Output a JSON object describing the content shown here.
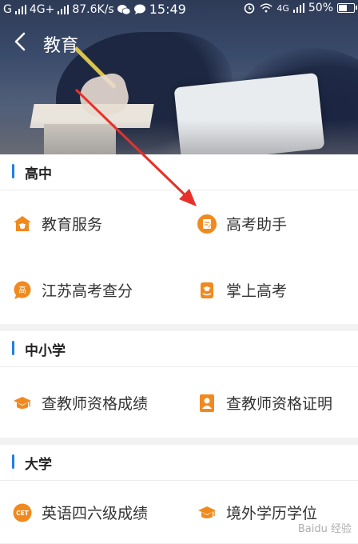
{
  "status_bar": {
    "carrier": "G",
    "network": "4G+",
    "speed": "87.6K/s",
    "time": "15:49",
    "network_right": "4G",
    "battery": "50%",
    "battery_level": 0.5
  },
  "header": {
    "title": "教育"
  },
  "sections": [
    {
      "label": "高中",
      "items": [
        {
          "label": "教育服务",
          "icon": "school-house-icon"
        },
        {
          "label": "高考助手",
          "icon": "exam-assistant-icon"
        },
        {
          "label": "江苏高考查分",
          "icon": "gao-badge-icon",
          "icon_text": "高"
        },
        {
          "label": "掌上高考",
          "icon": "palm-exam-icon"
        }
      ]
    },
    {
      "label": "中小学",
      "items": [
        {
          "label": "查教师资格成绩",
          "icon": "graduation-cap-icon"
        },
        {
          "label": "查教师资格证明",
          "icon": "id-card-icon"
        }
      ]
    },
    {
      "label": "大学",
      "items": [
        {
          "label": "英语四六级成绩",
          "icon": "cet-badge-icon",
          "icon_text": "CET"
        },
        {
          "label": "境外学历学位",
          "icon": "graduation-cap-icon"
        }
      ]
    }
  ],
  "colors": {
    "accent_orange": "#f08a1e",
    "section_marker_blue": "#1e80e6",
    "arrow_red": "#e8302a"
  },
  "watermark": "Baidu 经验"
}
